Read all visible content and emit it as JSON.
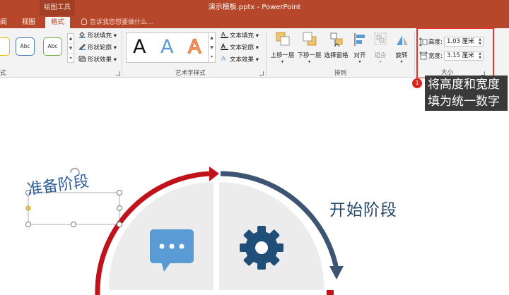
{
  "titlebar": {
    "context_tool": "绘图工具",
    "doc_title": "演示模板.pptx - PowerPoint"
  },
  "tabs": {
    "review_partial": "阅",
    "view": "视图",
    "format": "格式",
    "tell_me": "告诉我您想要做什么..."
  },
  "ribbon": {
    "shape_styles": {
      "group_label_partial": "式",
      "samples": [
        "Abc",
        "Abc",
        "Abc"
      ],
      "fill": "形状填充",
      "outline": "形状轮廓",
      "effects": "形状效果"
    },
    "wordart": {
      "group_label": "艺术字样式",
      "sample_letter": "A",
      "text_fill": "文本填充",
      "text_outline": "文本轮廓",
      "text_effects": "文本效果"
    },
    "arrange": {
      "group_label": "排列",
      "bring_forward": "上移一层",
      "send_backward": "下移一层",
      "selection_pane": "选择窗格",
      "align": "对齐",
      "group": "组合",
      "rotate": "旋转"
    },
    "size": {
      "group_label": "大小",
      "height_label": "高度:",
      "height_value": "1.03 厘米",
      "width_label": "宽度:",
      "width_value": "3.15 厘米"
    }
  },
  "annotation": {
    "badge": "1",
    "text_line1": "将高度和宽度",
    "text_line2": "填为统一数字"
  },
  "slide": {
    "heading_left": "准备阶段",
    "heading_right": "开始阶段"
  },
  "colors": {
    "accent": "#b7472a",
    "red_arc": "#c0121a",
    "navy_arc": "#3d5573",
    "chat_icon": "#5b9bd5",
    "gear_icon": "#1f4e79"
  }
}
